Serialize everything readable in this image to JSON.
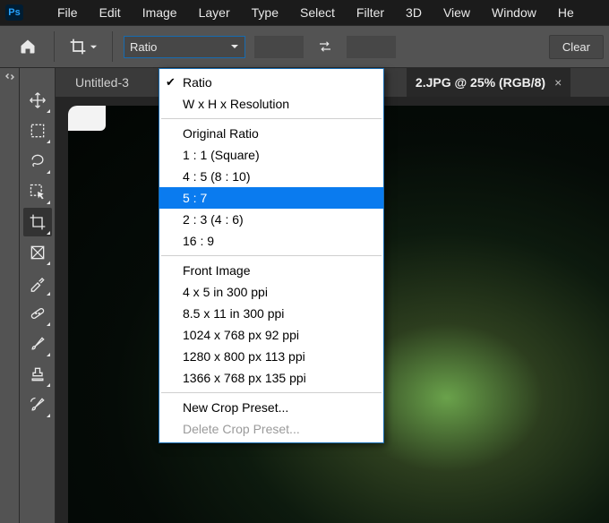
{
  "app": {
    "logo_text": "Ps"
  },
  "menu": {
    "items": [
      "File",
      "Edit",
      "Image",
      "Layer",
      "Type",
      "Select",
      "Filter",
      "3D",
      "View",
      "Window",
      "He"
    ]
  },
  "options": {
    "ratio_label": "Ratio",
    "clear_label": "Clear"
  },
  "tabs": {
    "inactive_label": "Untitled-3",
    "active_label": "2.JPG @ 25% (RGB/8)"
  },
  "dropdown": {
    "group1": [
      {
        "label": "Ratio",
        "checked": true
      },
      {
        "label": "W x H x Resolution",
        "checked": false
      }
    ],
    "group2_heading": "Original Ratio",
    "group2": [
      "1 : 1 (Square)",
      "4 : 5 (8 : 10)",
      "5 : 7",
      "2 : 3 (4 : 6)",
      "16 : 9"
    ],
    "group2_highlight_index": 2,
    "group3_heading": "Front Image",
    "group3": [
      "4 x 5 in 300 ppi",
      "8.5 x 11 in 300 ppi",
      "1024 x 768 px 92 ppi",
      "1280 x 800 px 113 ppi",
      "1366 x 768 px 135 ppi"
    ],
    "group4": [
      {
        "label": "New Crop Preset...",
        "disabled": false
      },
      {
        "label": "Delete Crop Preset...",
        "disabled": true
      }
    ]
  }
}
